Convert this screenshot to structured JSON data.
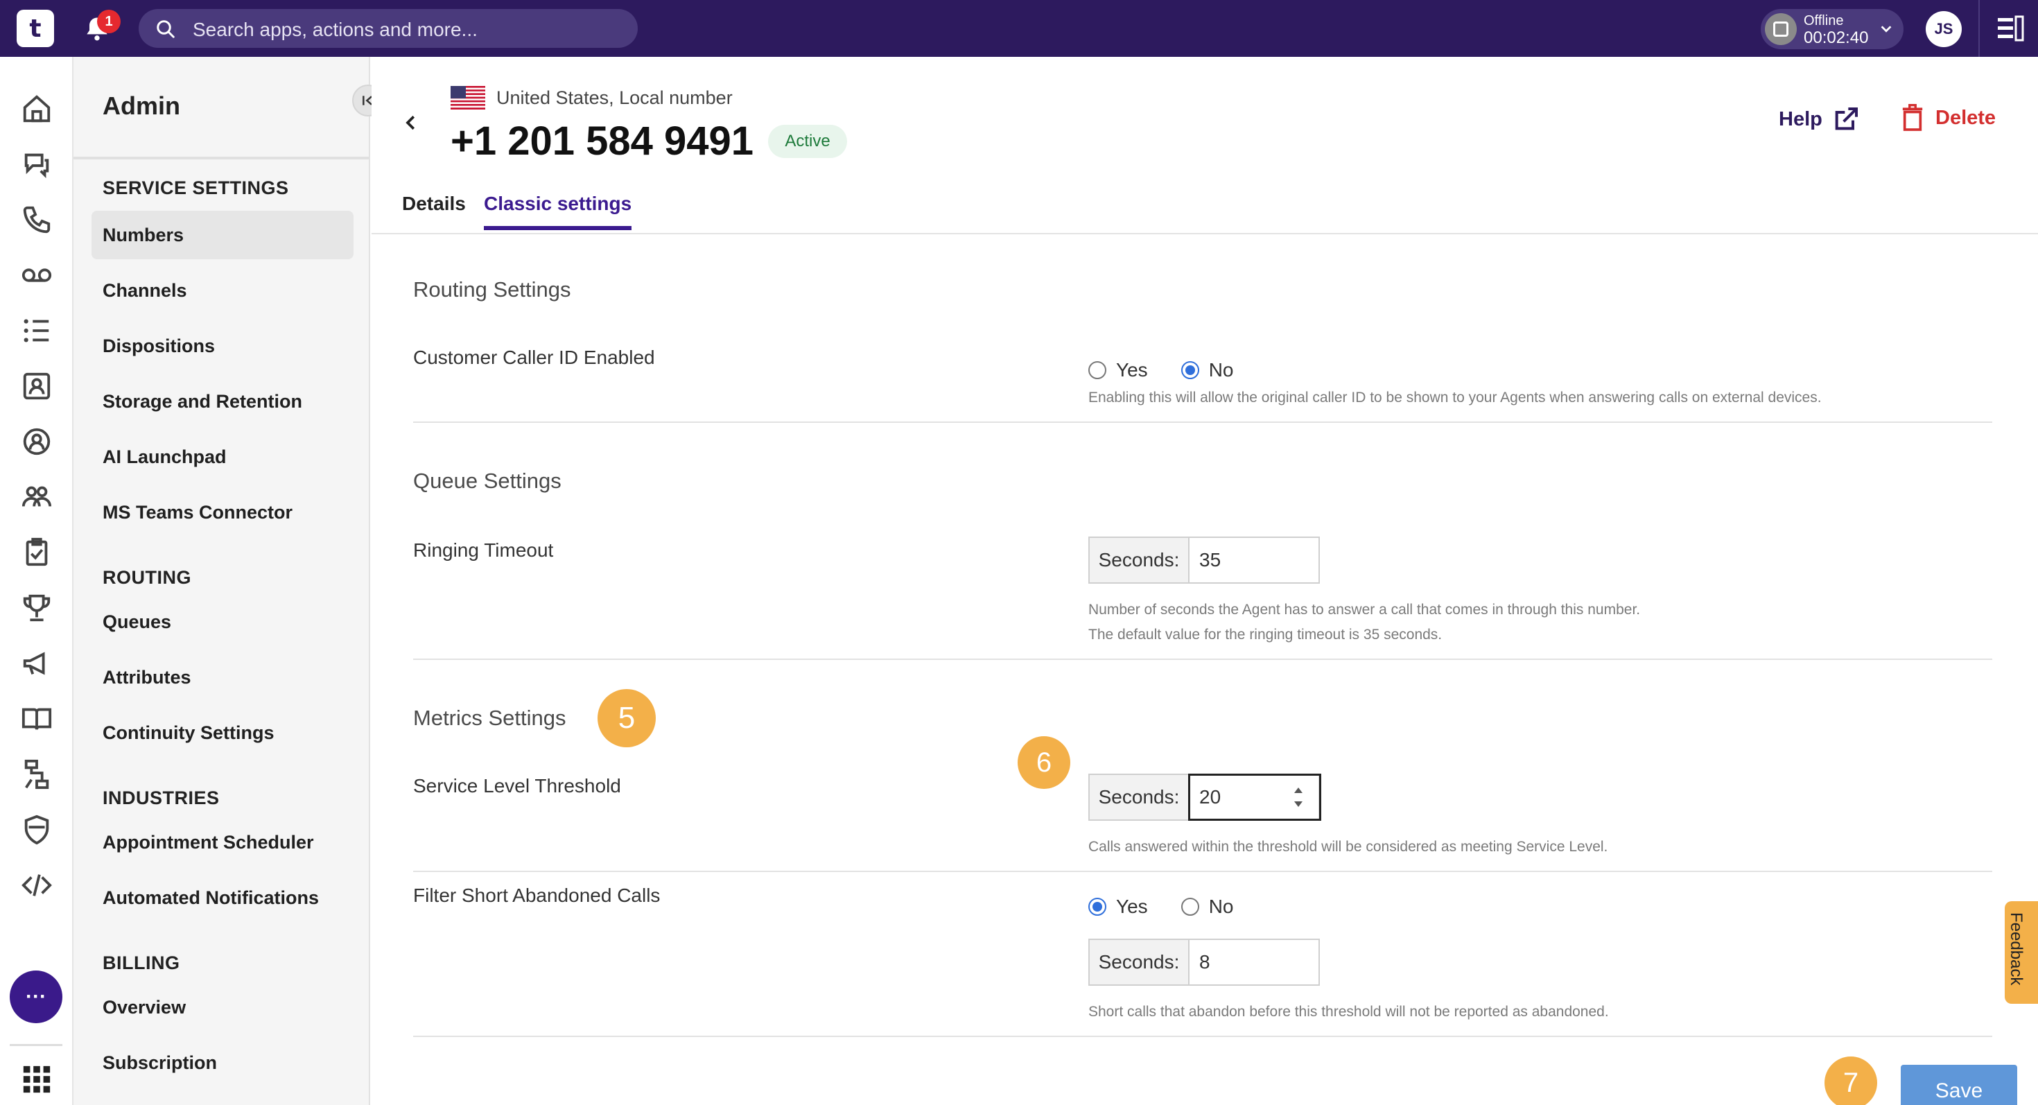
{
  "topbar": {
    "logo": "t",
    "notification_count": "1",
    "search_placeholder": "Search apps, actions and more...",
    "status_label": "Offline",
    "status_timer": "00:02:40",
    "avatar_initials": "JS"
  },
  "sidebar": {
    "title": "Admin",
    "sections": {
      "service_settings": "SERVICE SETTINGS",
      "routing": "ROUTING",
      "industries": "INDUSTRIES",
      "billing": "BILLING"
    },
    "items": {
      "numbers": "Numbers",
      "channels": "Channels",
      "dispositions": "Dispositions",
      "storage": "Storage and Retention",
      "ai_launchpad": "AI Launchpad",
      "ms_teams": "MS Teams Connector",
      "queues": "Queues",
      "attributes": "Attributes",
      "continuity": "Continuity Settings",
      "appointment": "Appointment Scheduler",
      "automated": "Automated Notifications",
      "overview": "Overview",
      "subscription": "Subscription"
    }
  },
  "header": {
    "number_type": "United States, Local number",
    "phone_number": "+1 201 584 9491",
    "status_badge": "Active",
    "help_label": "Help",
    "delete_label": "Delete"
  },
  "tabs": {
    "details": "Details",
    "classic": "Classic settings"
  },
  "routing": {
    "heading": "Routing Settings",
    "caller_id_label": "Customer Caller ID Enabled",
    "yes": "Yes",
    "no": "No",
    "selected": "No",
    "help": "Enabling this will allow the original caller ID to be shown to your Agents when answering calls on external devices."
  },
  "queue": {
    "heading": "Queue Settings",
    "ringing_label": "Ringing Timeout",
    "addon": "Seconds:",
    "value": "35",
    "help_line1": "Number of seconds the Agent has to answer a call that comes in through this number.",
    "help_line2": "The default value for the ringing timeout is 35 seconds."
  },
  "metrics": {
    "heading": "Metrics Settings",
    "threshold_label": "Service Level Threshold",
    "addon": "Seconds:",
    "threshold_value": "20",
    "threshold_help": "Calls answered within the threshold will be considered as meeting Service Level.",
    "filter_label": "Filter Short Abandoned Calls",
    "yes": "Yes",
    "no": "No",
    "filter_selected": "Yes",
    "filter_value": "8",
    "filter_help": "Short calls that abandon before this threshold will not be reported as abandoned."
  },
  "steps": {
    "five": "5",
    "six": "6",
    "seven": "7"
  },
  "actions": {
    "save": "Save",
    "feedback": "Feedback"
  },
  "colors": {
    "topbar": "#2d1a5e",
    "accent": "#3b1a8f",
    "step_badge": "#f3b049",
    "save": "#5f97d9",
    "delete": "#d32f2f",
    "active_badge_text": "#1d7a3a"
  },
  "icons": {
    "rail": [
      "home-icon",
      "chat-icon",
      "phone-icon",
      "voicemail-icon",
      "list-icon",
      "contacts-icon",
      "agent-icon",
      "team-icon",
      "clipboard-icon",
      "trophy-icon",
      "megaphone-icon",
      "book-icon",
      "workflow-icon",
      "shield-icon",
      "code-icon",
      "more-icon",
      "apps-grid-icon"
    ]
  }
}
